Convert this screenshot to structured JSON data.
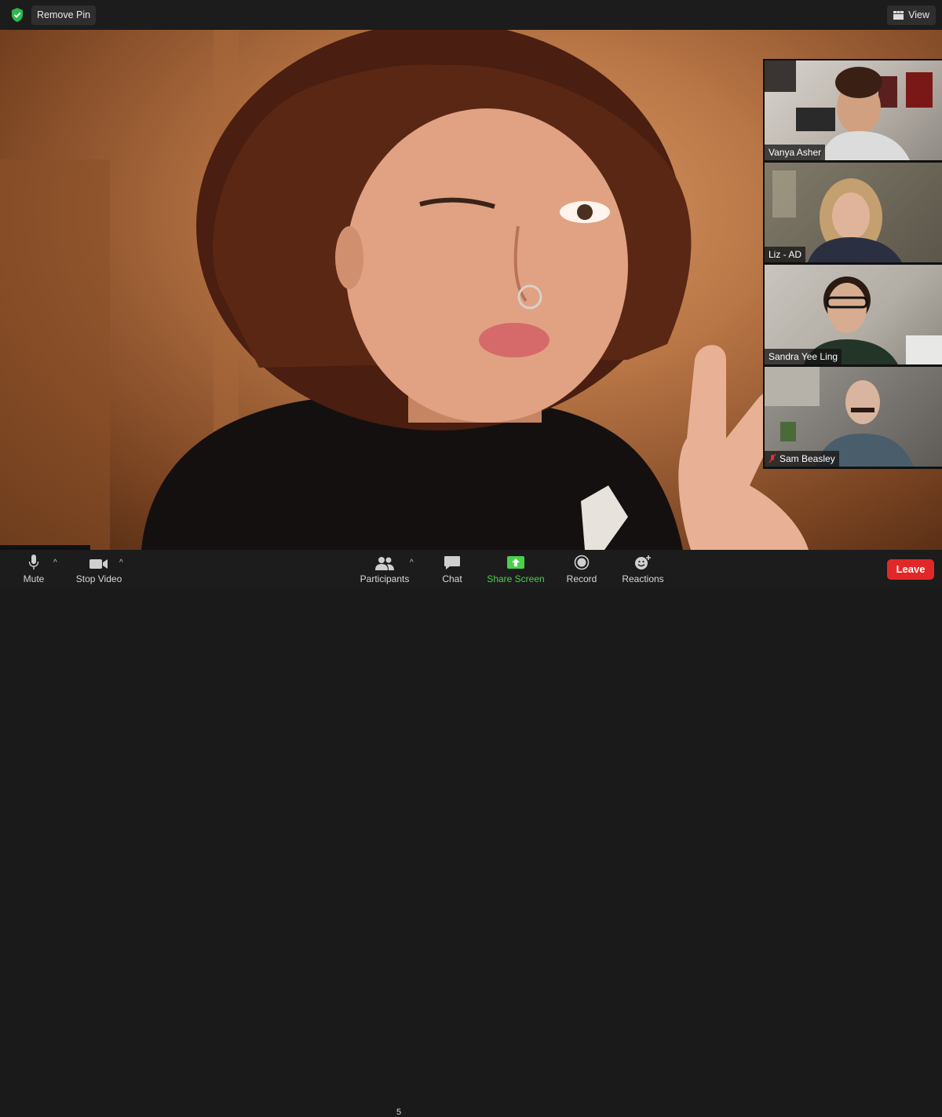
{
  "topbar": {
    "remove_pin_label": "Remove Pin",
    "view_label": "View"
  },
  "thumbnails": [
    {
      "name": "Vanya Asher",
      "muted": false
    },
    {
      "name": "Liz - AD",
      "muted": false
    },
    {
      "name": "Sandra Yee Ling",
      "muted": false
    },
    {
      "name": "Sam Beasley",
      "muted": true
    }
  ],
  "toolbar": {
    "mute_label": "Mute",
    "stop_video_label": "Stop Video",
    "participants_label": "Participants",
    "participants_count": "5",
    "chat_label": "Chat",
    "share_screen_label": "Share Screen",
    "record_label": "Record",
    "reactions_label": "Reactions",
    "leave_label": "Leave"
  },
  "colors": {
    "accent_green": "#4bd04b",
    "leave_red": "#e02828",
    "bar_bg": "#1c1c1c"
  },
  "icons": [
    "shield-check-icon",
    "view-grid-icon",
    "microphone-icon",
    "video-camera-icon",
    "participants-icon",
    "chat-bubble-icon",
    "share-screen-arrow-icon",
    "record-icon",
    "reactions-smiley-icon",
    "muted-mic-icon"
  ]
}
